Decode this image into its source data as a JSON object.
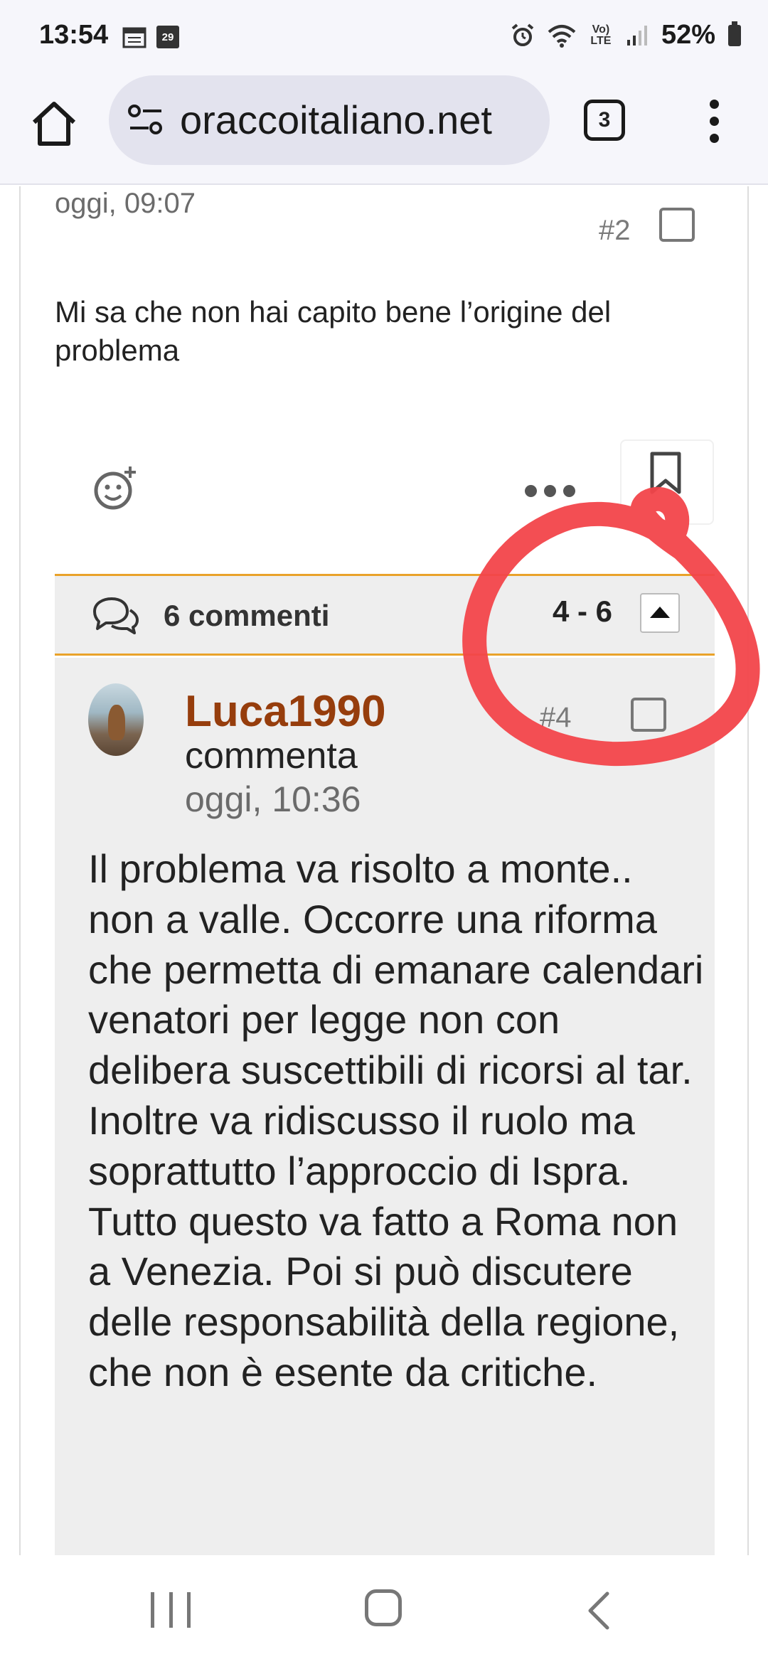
{
  "status": {
    "time": "13:54",
    "calendar_day": "29",
    "network_label": "Vo) LTE",
    "battery": "52%"
  },
  "browser": {
    "url": "oraccoitaliano.net",
    "tab_count": "3"
  },
  "post": {
    "date": "oggi, 09:07",
    "number": "#2",
    "body": "Mi sa che non hai capito bene l’origine del problema"
  },
  "comments_bar": {
    "label": "6 commenti",
    "range": "4 - 6"
  },
  "comment": {
    "user": "Luca1990",
    "action": "commenta",
    "date": "oggi, 10:36",
    "number": "#4",
    "body": "Il problema va risolto a monte.. non a valle. Occorre una riforma che permetta di emanare calendari venatori per legge non con delibera suscettibili di ricorsi al tar. Inoltre va ridiscusso il ruolo ma soprattutto l’approccio di Ispra. Tutto questo va fatto a Roma non a Venezia. Poi si può discutere delle responsabilità della regione, che non è esente da critiche."
  },
  "colors": {
    "accent_orange": "#e9a22a",
    "username": "#963d0c",
    "annotation_red": "#f2444a"
  },
  "icons": [
    "calendar-icon",
    "alarm-icon",
    "wifi-icon",
    "signal-icon",
    "battery-icon",
    "home-icon",
    "site-settings-icon",
    "tabs-icon",
    "menu-icon",
    "add-reaction-icon",
    "more-icon",
    "bookmark-icon",
    "comments-icon",
    "collapse-icon",
    "recent-apps-icon",
    "home-nav-icon",
    "back-icon"
  ]
}
